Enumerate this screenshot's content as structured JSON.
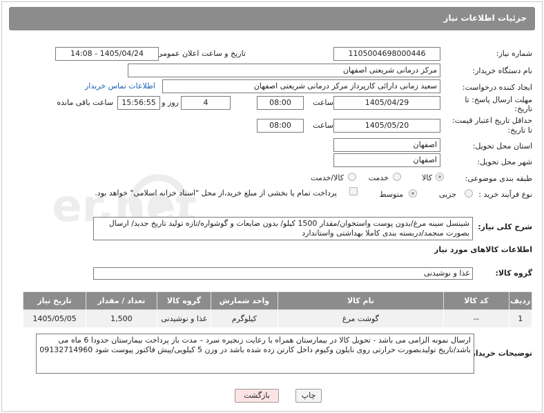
{
  "header": {
    "title": "جزئیات اطلاعات نیاز"
  },
  "form": {
    "need_number": {
      "label": "شماره نیاز:",
      "value": "1105004698000446"
    },
    "announce_datetime": {
      "label": "تاریخ و ساعت اعلان عمومی:",
      "value": "1405/04/24 - 14:08"
    },
    "buyer_org": {
      "label": "نام دستگاه خریدار:",
      "value": "مرکز درمانی شریعتی اصفهان"
    },
    "requester": {
      "label": "ایجاد کننده درخواست:",
      "value": "سعید زمانی دارائی کارپرداز مرکز درمانی شریعتی اصفهان",
      "contact_link": "اطلاعات تماس خریدار"
    },
    "response_deadline": {
      "label_line1": "مهلت ارسال پاسخ: تا",
      "label_line2": "تاریخ:",
      "date": "1405/04/29",
      "time_label": "ساعت",
      "time": "08:00",
      "days": "4",
      "days_label": "روز و",
      "remaining": "15:56:55",
      "remaining_label": "ساعت باقی مانده"
    },
    "price_validity": {
      "label_line1": "حداقل تاریخ اعتبار قیمت:",
      "label_line2": "تا تاریخ:",
      "date": "1405/05/20",
      "time_label": "ساعت",
      "time": "08:00"
    },
    "province": {
      "label": "استان محل تحویل:",
      "value": "اصفهان"
    },
    "city": {
      "label": "شهر محل تحویل:",
      "value": "اصفهان"
    },
    "category": {
      "label": "طبقه بندی موضوعی:",
      "options": [
        "کالا",
        "خدمت",
        "کالا/خدمت"
      ],
      "selected": "کالا"
    },
    "purchase_type": {
      "label": "نوع فرآیند خرید :",
      "options": [
        "جزیی",
        "متوسط"
      ],
      "selected": "متوسط",
      "payment_note": "پرداخت تمام یا بخشی از مبلغ خرید،از محل \"اسناد خزانه اسلامی\" خواهد بود."
    }
  },
  "description": {
    "label": "شرح کلی نیاز:",
    "text": "شینسل سینه مرغ/بدون پوست واستخوان/مقدار 1500 کیلو/ بدون ضایعات و گوشواره/تازه تولید تاریخ جدید/ ارسال بصورت منجمد/دربسته بندی کاملا بهداشتی واستاندارد"
  },
  "goods": {
    "section_title": "اطلاعات کالاهای مورد نیاز",
    "group_label": "گروه کالا:",
    "group_value": "غذا و نوشیدنی",
    "columns": [
      "ردیف",
      "کد کالا",
      "نام کالا",
      "واحد شمارش",
      "گروه کالا",
      "تعداد / مقدار",
      "تاریخ نیاز"
    ],
    "rows": [
      {
        "index": "1",
        "code": "--",
        "name": "گوشت مرغ",
        "unit": "کیلوگرم",
        "group": "غذا و نوشیدنی",
        "quantity": "1,500",
        "date": "1405/05/05"
      }
    ]
  },
  "buyer_notes": {
    "label": "توضیحات خریدار:",
    "text": "ارسال نمونه الزامی می باشد - تحویل کالا در بیمارستان همراه با رعایت زنجیره سرد – مدت باز پرداخت بیمارستان حدودا  6 ماه می باشد/تاریخ تولیدبصورت حرارتی روی نایلون وکیوم داخل کارتن زده شده باشد در وزن 5 کیلویی/پیش فاکتور پیوست شود 09132714960"
  },
  "buttons": {
    "print": "چاپ",
    "back": "بازگشت"
  },
  "watermark": {
    "text": "AriaTender.net"
  },
  "colors": {
    "header_bg": "#8c8c8c",
    "link": "#1a5fb4",
    "back_button_bg": "#fde3e3"
  }
}
